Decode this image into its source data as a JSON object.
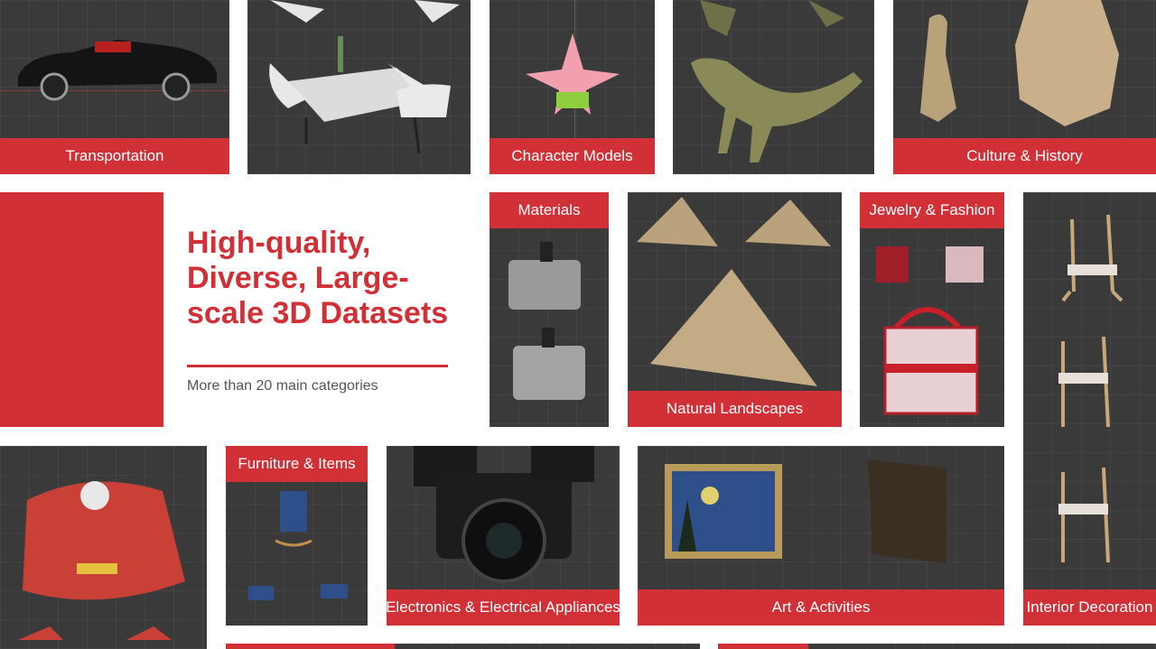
{
  "headline": {
    "lines": [
      "High-quality,",
      "Diverse, Large-",
      "scale 3D Datasets"
    ],
    "subtitle": "More than 20 main categories"
  },
  "categories": {
    "transportation": "Transportation",
    "character_models": "Character Models",
    "culture_history": "Culture & History",
    "materials": "Materials",
    "jewelry_fashion": "Jewelry & Fashion",
    "natural_landscapes": "Natural Landscapes",
    "furniture_items": "Furniture & Items",
    "electronics": "Electronics & Electrical Appliances",
    "art_activities": "Art & Activities",
    "interior_decoration": "Interior Decoration"
  },
  "colors": {
    "accent": "#d03036",
    "tile_bg": "#3a3a3a",
    "text_gray": "#555555"
  },
  "icons": {
    "car": "car-model",
    "dining_set": "dining-table-set",
    "starfish": "starfish-character",
    "dinosaur": "t-rex",
    "warrior": "terracotta-warrior",
    "pot": "pressure-cooker",
    "pyramid": "pyramid",
    "handbag": "tote-bag",
    "stool": "bar-stool",
    "race_car": "race-car",
    "rocking_chair": "rocking-chair",
    "camera": "dslr-camera",
    "painting": "framed-painting"
  }
}
